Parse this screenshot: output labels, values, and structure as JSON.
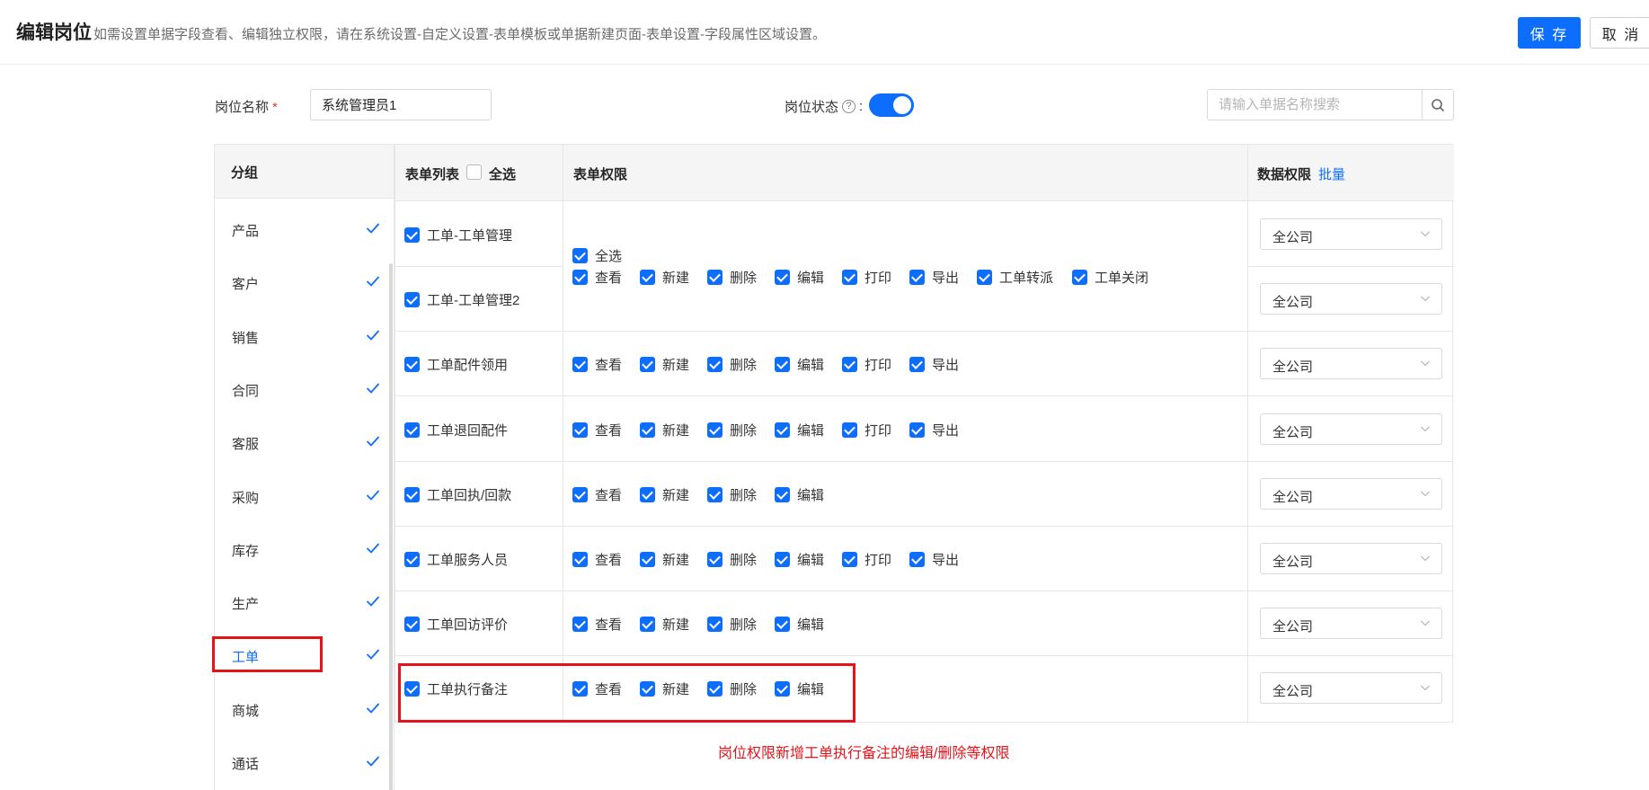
{
  "header": {
    "title": "编辑岗位",
    "hint": "如需设置单据字段查看、编辑独立权限，请在系统设置-自定义设置-表单模板或单据新建页面-表单设置-字段属性区域设置。",
    "save_label": "保 存",
    "cancel_label": "取 消"
  },
  "form": {
    "name_label": "岗位名称",
    "required_mark": "*",
    "name_value": "系统管理员1",
    "status_label": "岗位状态",
    "status_help": "?",
    "status_colon": ":",
    "status_on": true,
    "search_placeholder": "请输入单据名称搜索"
  },
  "sidebar": {
    "header": "分组",
    "items": [
      {
        "label": "产品"
      },
      {
        "label": "客户"
      },
      {
        "label": "销售"
      },
      {
        "label": "合同"
      },
      {
        "label": "客服"
      },
      {
        "label": "采购"
      },
      {
        "label": "库存"
      },
      {
        "label": "生产"
      },
      {
        "label": "工单"
      },
      {
        "label": "商城"
      },
      {
        "label": "通话"
      }
    ],
    "active_index": 8
  },
  "table": {
    "col_forms": "表单列表",
    "col_select_all": "全选",
    "col_perms": "表单权限",
    "col_data": "数据权限",
    "col_batch": "批量",
    "merged_select_all": "全选",
    "rows": [
      {
        "name": "工单-工单管理",
        "scope": "全公司"
      },
      {
        "name": "工单-工单管理2",
        "scope": "全公司"
      },
      {
        "name": "工单配件领用",
        "scope": "全公司"
      },
      {
        "name": "工单退回配件",
        "scope": "全公司"
      },
      {
        "name": "工单回执/回款",
        "scope": "全公司"
      },
      {
        "name": "工单服务人员",
        "scope": "全公司"
      },
      {
        "name": "工单回访评价",
        "scope": "全公司"
      },
      {
        "name": "工单执行备注",
        "scope": "全公司"
      }
    ],
    "perm_labels": {
      "view": "查看",
      "create": "新建",
      "delete": "删除",
      "edit": "编辑",
      "print": "打印",
      "export": "导出",
      "transfer": "工单转派",
      "close": "工单关闭"
    }
  },
  "annotation": {
    "note": "岗位权限新增工单执行备注的编辑/删除等权限"
  }
}
